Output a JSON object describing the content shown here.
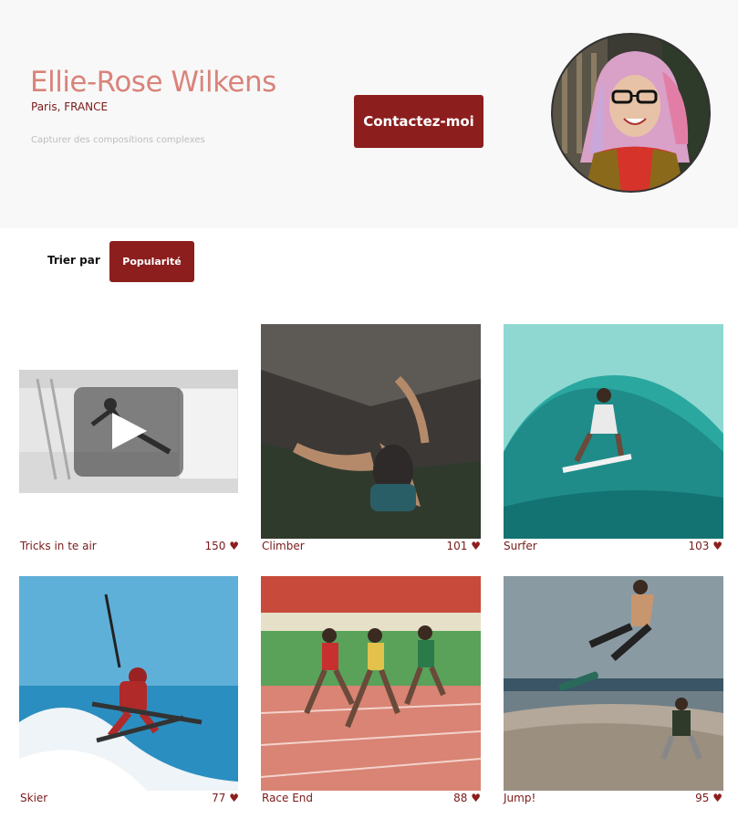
{
  "profile": {
    "name": "Ellie-Rose Wilkens",
    "location": "Paris, FRANCE",
    "tagline": "Capturer des compositions complexes",
    "contact_label": "Contactez-moi"
  },
  "sort": {
    "label": "Trier par",
    "selected": "Popularité"
  },
  "cards": [
    {
      "title": "Tricks in te air",
      "count": "150",
      "type": "video"
    },
    {
      "title": "Climber",
      "count": "101",
      "type": "photo"
    },
    {
      "title": "Surfer",
      "count": "103",
      "type": "photo"
    },
    {
      "title": "Skier",
      "count": "77",
      "type": "photo"
    },
    {
      "title": "Race End",
      "count": "88",
      "type": "photo"
    },
    {
      "title": "Jump!",
      "count": "95",
      "type": "photo"
    }
  ],
  "colors": {
    "accent": "#8c1e1e",
    "name": "#d9837a",
    "header_bg": "#f8f8f8"
  },
  "icons": {
    "like": "heart-icon",
    "play": "play-icon"
  }
}
